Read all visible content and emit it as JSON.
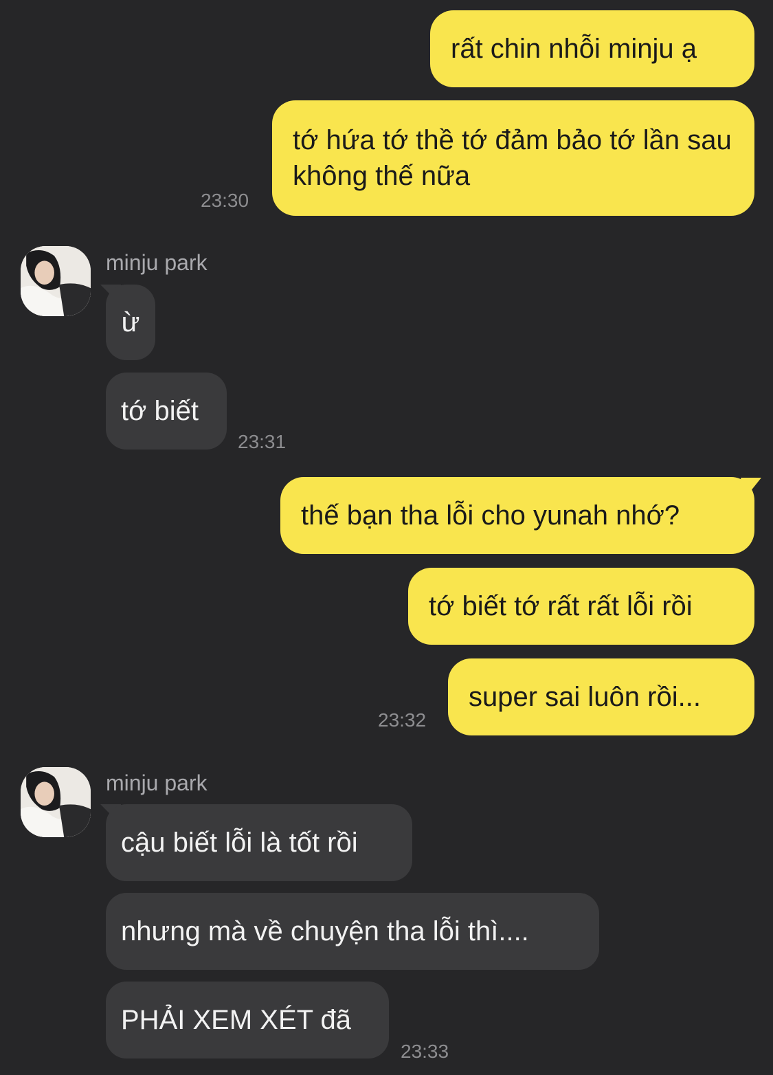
{
  "colors": {
    "background": "#262628",
    "my_bubble": "#f9e54e",
    "their_bubble": "#3a3a3c"
  },
  "messages": {
    "m1": {
      "sender": "me",
      "text": "rất chin nhỗi minju ạ"
    },
    "m2": {
      "sender": "me",
      "text": "tớ hứa tớ thề tớ đảm bảo tớ lần sau không thế nữa",
      "time": "23:30"
    },
    "g1": {
      "sender_name": "minju park",
      "m3": {
        "text": "ừ"
      },
      "m4": {
        "text": "tớ biết",
        "time": "23:31"
      }
    },
    "m5": {
      "sender": "me",
      "text": "thế bạn tha lỗi cho yunah nhớ?"
    },
    "m6": {
      "sender": "me",
      "text": "tớ biết tớ rất rất lỗi rồi"
    },
    "m7": {
      "sender": "me",
      "text": "super sai luôn rồi...",
      "time": "23:32"
    },
    "g2": {
      "sender_name": "minju park",
      "m8": {
        "text": "cậu biết lỗi là tốt rồi"
      },
      "m9": {
        "text": "nhưng mà về chuyện tha lỗi thì...."
      },
      "m10": {
        "text": "PHẢI XEM XÉT đã",
        "time": "23:33"
      }
    }
  }
}
